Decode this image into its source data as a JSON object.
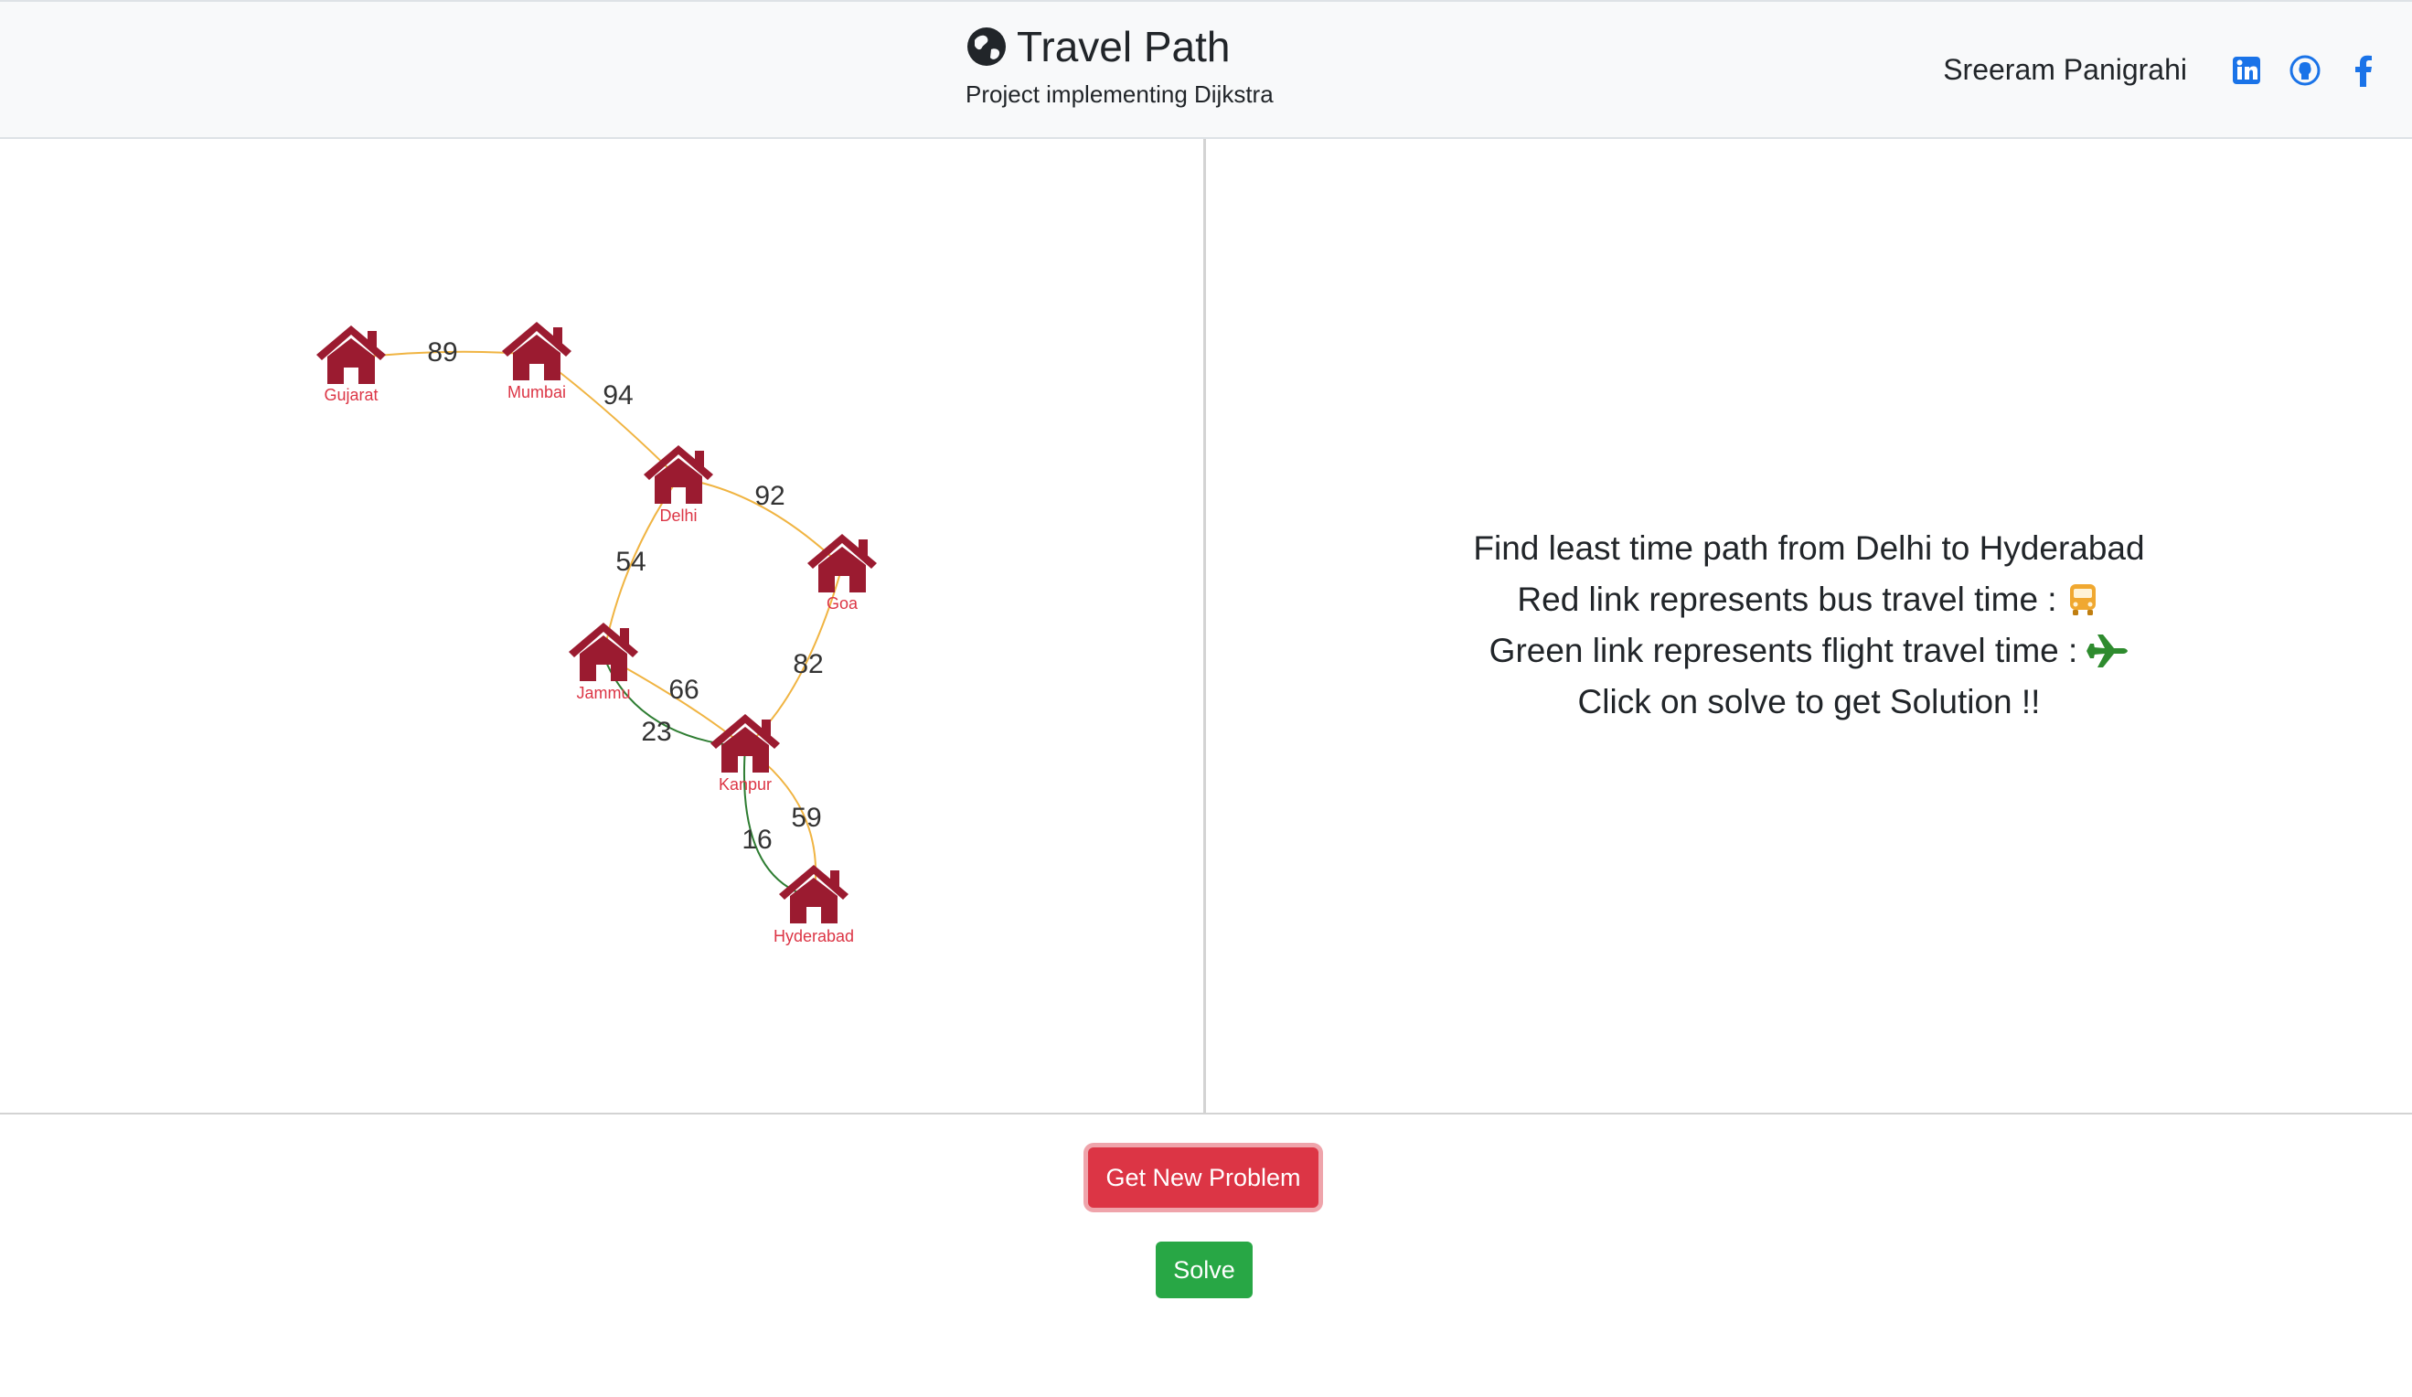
{
  "header": {
    "title": "Travel Path",
    "subtitle": "Project implementing Dijkstra",
    "author": "Sreeram Panigrahi",
    "social": [
      "linkedin-icon",
      "github-icon",
      "facebook-icon"
    ]
  },
  "graph": {
    "nodes": [
      "Gujarat",
      "Mumbai",
      "Delhi",
      "Goa",
      "Jammu",
      "Kanpur",
      "Hyderabad"
    ],
    "edges": [
      {
        "from": "Gujarat",
        "to": "Mumbai",
        "weight": "89",
        "mode": "bus"
      },
      {
        "from": "Mumbai",
        "to": "Delhi",
        "weight": "94",
        "mode": "bus"
      },
      {
        "from": "Delhi",
        "to": "Goa",
        "weight": "92",
        "mode": "bus"
      },
      {
        "from": "Delhi",
        "to": "Jammu",
        "weight": "54",
        "mode": "bus"
      },
      {
        "from": "Goa",
        "to": "Kanpur",
        "weight": "82",
        "mode": "bus"
      },
      {
        "from": "Jammu",
        "to": "Kanpur",
        "weight": "66",
        "mode": "bus"
      },
      {
        "from": "Jammu",
        "to": "Kanpur",
        "weight": "23",
        "mode": "flight"
      },
      {
        "from": "Kanpur",
        "to": "Hyderabad",
        "weight": "59",
        "mode": "bus"
      },
      {
        "from": "Kanpur",
        "to": "Hyderabad",
        "weight": "16",
        "mode": "flight"
      }
    ],
    "colors": {
      "bus": "#f0b442",
      "flight": "#2e7d32",
      "node": "#9b1b30"
    }
  },
  "instructions": {
    "line1": "Find least time path from Delhi to Hyderabad",
    "line2": "Red link represents bus travel time :",
    "line3": "Green link represents flight travel time :",
    "line4": "Click on solve to get Solution !!"
  },
  "buttons": {
    "new_problem": "Get New Problem",
    "solve": "Solve"
  },
  "colors": {
    "danger": "#dc3545",
    "success": "#28a745",
    "bus_icon": "#f0a830",
    "plane_icon": "#2e8b2e"
  }
}
